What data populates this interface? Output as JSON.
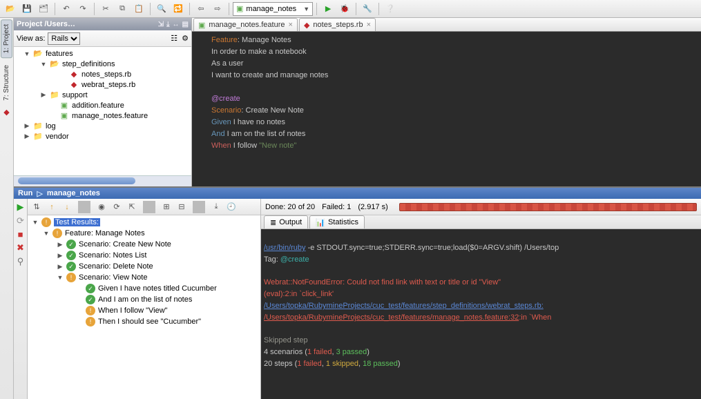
{
  "toolbar": {
    "run_config_label": "manage_notes"
  },
  "left_tabs": {
    "project": "1: Project",
    "structure": "7: Structure"
  },
  "project": {
    "title": "Project /Users…",
    "view_as_label": "View as:",
    "view_as_value": "Rails",
    "tree": {
      "features": "features",
      "step_definitions": "step_definitions",
      "notes_steps": "notes_steps.rb",
      "webrat_steps": "webrat_steps.rb",
      "support": "support",
      "addition_feature": "addition.feature",
      "manage_notes_feature": "manage_notes.feature",
      "log": "log",
      "vendor": "vendor"
    }
  },
  "editor": {
    "tabs": {
      "t1": "manage_notes.feature",
      "t2": "notes_steps.rb"
    },
    "code": {
      "l1_kw": "Feature",
      "l1_rest": ": Manage Notes",
      "l2": "  In order to make a notebook",
      "l3": "  As a user",
      "l4": "  I want to create and manage notes",
      "tag": "  @create",
      "l6_kw": "  Scenario",
      "l6_rest": ": Create New Note",
      "l7_kw": "    Given",
      "l7_rest": " I have no notes",
      "l8_kw": "    And",
      "l8_rest": " I am on the list of notes",
      "l9_kw": "    When",
      "l9_rest": " I follow ",
      "l9_str": "\"New note\""
    }
  },
  "run": {
    "title_prefix": "Run",
    "config": "manage_notes",
    "status_done": "Done: 20 of 20",
    "status_failed": "Failed: 1",
    "status_time": "(2.917 s)",
    "tabs": {
      "output": "Output",
      "statistics": "Statistics"
    },
    "tree": {
      "root": "Test Results:",
      "feature": "Feature: Manage Notes",
      "s1": "Scenario: Create New Note",
      "s2": "Scenario: Notes List",
      "s3": "Scenario: Delete Note",
      "s4": "Scenario: View Note",
      "s4a": "Given I have notes titled Cucumber",
      "s4b": "And I am on the list of notes",
      "s4c": "When I follow \"View\"",
      "s4d": "Then I should see \"Cucumber\""
    },
    "console": {
      "l1a": "/usr/bin/ruby",
      "l1b": " -e STDOUT.sync=true;STDERR.sync=true;load($0=ARGV.shift) /Users/top",
      "l2a": "Tag: ",
      "l2b": "@create",
      "l4": "Webrat::NotFoundError: Could not find link with text or title or id \"View\"",
      "l5": "(eval):2:in `click_link'",
      "l6": "/Users/topka/RubymineProjects/cuc_test/features/step_definitions/webrat_steps.rb:",
      "l7a": "/Users/topka/RubymineProjects/cuc_test/features/manage_notes.feature:32",
      "l7b": ":in `When ",
      "l9": "Skipped step",
      "l10a": "4 scenarios (",
      "l10b": "1 failed",
      "l10c": ", ",
      "l10d": "3 passed",
      "l10e": ")",
      "l11a": "20 steps (",
      "l11b": "1 failed",
      "l11c": ", ",
      "l11d": "1 skipped",
      "l11e": ", ",
      "l11f": "18 passed",
      "l11g": ")"
    }
  }
}
